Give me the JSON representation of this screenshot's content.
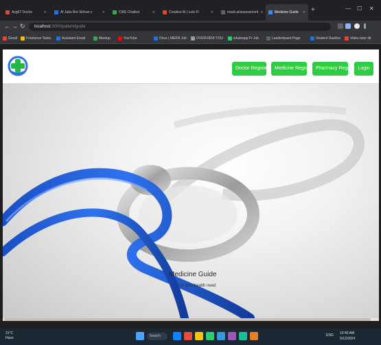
{
  "browser": {
    "tabs": [
      {
        "label": "Avg67 Doctor",
        "fav": "#d64b3a"
      },
      {
        "label": "Al Jaba Bot Sinhan v",
        "fav": "#1a73e8"
      },
      {
        "label": "CMS Chatbot",
        "fav": "#34a853"
      },
      {
        "label": "Creative AI | Lets Fi",
        "fav": "#ea4335"
      },
      {
        "label": "mask.ai/assessment",
        "fav": "#5f6368"
      },
      {
        "label": "Medicine Guide",
        "fav": "#4285f4"
      }
    ],
    "active_tab_index": 5,
    "new_tab_symbol": "+",
    "window_controls": [
      "—",
      "☐",
      "✕"
    ],
    "nav": {
      "back": "←",
      "forward": "→",
      "reload": "↻"
    },
    "address": {
      "host": "localhost",
      "path": ":3000/patient/guide"
    },
    "bookmarks": [
      {
        "label": "Gmail",
        "fav": "#ea4335"
      },
      {
        "label": "Freelance Tasks",
        "fav": "#fbbc04"
      },
      {
        "label": "Assistant Email",
        "fav": "#1a73e8"
      },
      {
        "label": "Meetup",
        "fav": "#34a853"
      },
      {
        "label": "YouTube",
        "fav": "#ff0000"
      },
      {
        "label": "Drive | MERN Job",
        "fav": "#1a73e8"
      },
      {
        "label": "OVERVIEW YOU",
        "fav": "#9aa0a6"
      },
      {
        "label": "whatsapp Fr Job",
        "fav": "#25d366"
      },
      {
        "label": "Leaderboard Page",
        "fav": "#5f6368"
      },
      {
        "label": "Student Dashbo",
        "fav": "#1a73e8"
      },
      {
        "label": "Video tutor lib",
        "fav": "#ea4335"
      }
    ]
  },
  "site": {
    "nav_buttons": [
      "Doctor Register",
      "Medicine Register",
      "Pharmacy Register",
      "Login"
    ],
    "hero": {
      "title": "Medicine Guide",
      "subtitle": "For your health need"
    }
  },
  "taskbar": {
    "weather": {
      "temp": "31°C",
      "desc": "Haze"
    },
    "search": "Search",
    "apps": [
      "#0a84ff",
      "#e74c3c",
      "#f1c40f",
      "#2ecc71",
      "#3498db",
      "#9b59b6",
      "#1abc9c",
      "#e67e22"
    ],
    "tray_text": "ENG",
    "time": "10:40 AM",
    "date": "5/12/2024"
  },
  "colors": {
    "nav_button": "#2ecc40",
    "stethoscope": "#1f5fd6"
  }
}
